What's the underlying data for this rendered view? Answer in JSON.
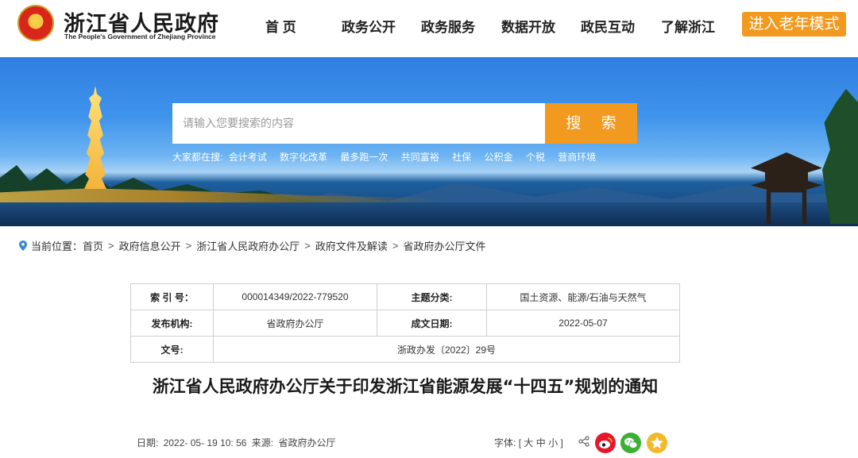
{
  "header": {
    "title": "浙江省人民政府",
    "subtitle": "The People's Government of Zhejiang Province",
    "nav": [
      "首 页",
      "政务公开",
      "政务服务",
      "数据开放",
      "政民互动",
      "了解浙江"
    ],
    "elder_mode": "进入老年模式"
  },
  "search": {
    "placeholder": "请输入您要搜索的内容",
    "button": "搜 索",
    "hot_label": "大家都在搜:",
    "hot_words": [
      "会计考试",
      "数字化改革",
      "最多跑一次",
      "共同富裕",
      "社保",
      "公积金",
      "个税",
      "营商环境"
    ]
  },
  "breadcrumb": {
    "label": "当前位置：",
    "items": [
      "首页",
      "政府信息公开",
      "浙江省人民政府办公厅",
      "政府文件及解读",
      "省政府办公厅文件"
    ]
  },
  "meta": {
    "index_label": "索 引 号：",
    "index_value": "000014349/2022-779520",
    "topic_label": "主题分类:",
    "topic_value": "国土资源、能源/石油与天然气",
    "issuer_label": "发布机构:",
    "issuer_value": "省政府办公厅",
    "date_label": "成文日期:",
    "date_value": "2022-05-07",
    "docno_label": "文号:",
    "docno_value": "浙政办发〔2022〕29号"
  },
  "doc": {
    "title": "浙江省人民政府办公厅关于印发浙江省能源发展“十四五”规划的通知",
    "date_label": "日期:",
    "date_value": "2022- 05- 19 10: 56",
    "source_label": "来源:",
    "source_value": "省政府办公厅",
    "font_label": "字体:",
    "font_open": "[",
    "font_large": "大",
    "font_medium": "中",
    "font_small": "小",
    "font_close": "]"
  },
  "icons": {
    "location": "map-pin-icon",
    "share": "share-icon",
    "weibo": "weibo-icon",
    "wechat": "wechat-icon",
    "favorite": "star-icon"
  },
  "colors": {
    "accent": "#f29a1f",
    "weibo": "#e6162d",
    "wechat": "#3cb034",
    "favorite": "#f2b92a"
  }
}
